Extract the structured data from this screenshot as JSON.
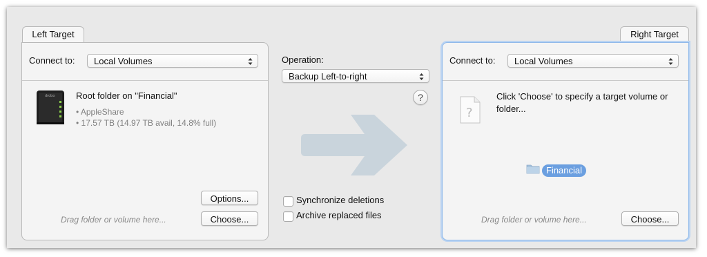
{
  "left_target": {
    "tab_label": "Left Target",
    "connect_label": "Connect to:",
    "connect_value": "Local Volumes",
    "volume_title": "Root folder on \"Financial\"",
    "volume_details": [
      "• AppleShare",
      "• 17.57 TB (14.97 TB avail, 14.8% full)"
    ],
    "options_button": "Options...",
    "choose_button": "Choose...",
    "drag_hint": "Drag folder or volume here..."
  },
  "center": {
    "operation_label": "Operation:",
    "operation_value": "Backup Left-to-right",
    "help_button": "?",
    "checkboxes": [
      {
        "label": "Synchronize deletions",
        "checked": false
      },
      {
        "label": "Archive replaced files",
        "checked": false
      }
    ]
  },
  "right_target": {
    "tab_label": "Right Target",
    "connect_label": "Connect to:",
    "connect_value": "Local Volumes",
    "prompt_text": "Click 'Choose' to specify a target volume or folder...",
    "folder_label": "Financial",
    "choose_button": "Choose...",
    "drag_hint": "Drag folder or volume here..."
  },
  "colors": {
    "accent": "#6b9fe0",
    "focus_ring": "#8fb9ea",
    "arrow": "#c9d4dc"
  }
}
